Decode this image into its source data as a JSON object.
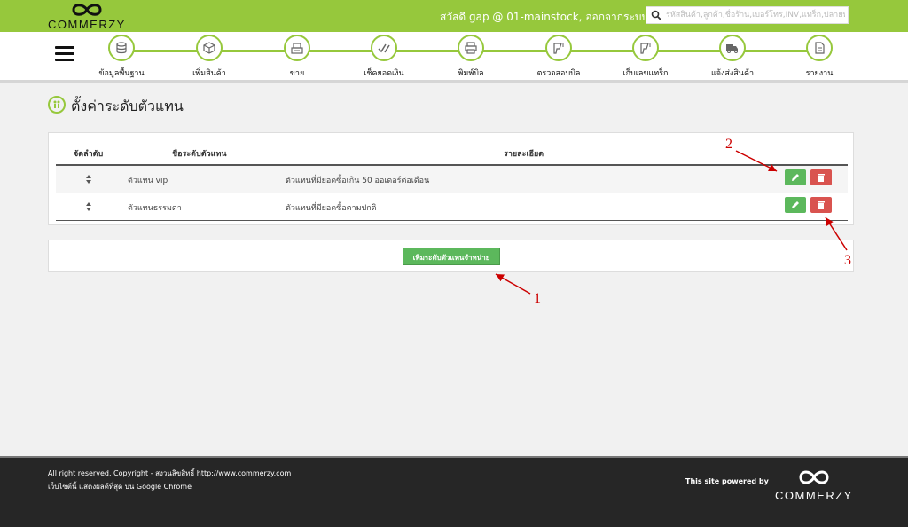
{
  "header": {
    "logo_text": "COMMERZY",
    "greeting_prefix": "สวัสดี",
    "user": "gap @ 01-mainstock,",
    "logout": "ออกจากระบบ",
    "search_placeholder": "รหัสสินค้า,ลูกค้า,ชื่อร้าน,เบอร์โทร,INV,แทร็ก,ปลายทาง"
  },
  "nav": {
    "items": [
      {
        "label": "ข้อมูลพื้นฐาน",
        "icon": "database-icon"
      },
      {
        "label": "เพิ่มสินค้า",
        "icon": "box-icon"
      },
      {
        "label": "ขาย",
        "icon": "cash-register-icon"
      },
      {
        "label": "เช็คยอดเงิน",
        "icon": "check-pen-icon"
      },
      {
        "label": "พิมพ์บิล",
        "icon": "printer-icon"
      },
      {
        "label": "ตรวจสอบบิล",
        "icon": "barcode-scanner-icon"
      },
      {
        "label": "เก็บเลขแทร็ก",
        "icon": "barcode-scanner-icon"
      },
      {
        "label": "แจ้งส่งสินค้า",
        "icon": "truck-icon"
      },
      {
        "label": "รายงาน",
        "icon": "report-icon"
      }
    ]
  },
  "page": {
    "title": "ตั้งค่าระดับตัวแทน",
    "title_icon": "agent-level-icon"
  },
  "table": {
    "headers": {
      "order": "จัดลำดับ",
      "name": "ชื่อระดับตัวแทน",
      "detail": "รายละเอียด"
    },
    "rows": [
      {
        "name": "ตัวแทน vip",
        "detail": "ตัวแทนที่มียอดซื้อเกิน 50 ออเดอร์ต่อเดือน"
      },
      {
        "name": "ตัวแทนธรรมดา",
        "detail": "ตัวแทนที่มียอดซื้อตามปกติ"
      }
    ]
  },
  "add_button_label": "เพิ่มระดับตัวแทนจำหน่าย",
  "annotations": {
    "a1": "1",
    "a2": "2",
    "a3": "3"
  },
  "footer": {
    "copyright": "All right reserved. Copyright - สงวนลิขสิทธิ์ http://www.commerzy.com",
    "browser_note": "เว็บไซต์นี้ แสดงผลดีที่สุด บน Google Chrome",
    "powered_by": "This site powered by",
    "logo_text": "COMMERZY"
  },
  "colors": {
    "brand_green": "#96c83c",
    "edit_green": "#5cb85c",
    "delete_red": "#d9534f",
    "annotation_red": "#cc0000"
  }
}
